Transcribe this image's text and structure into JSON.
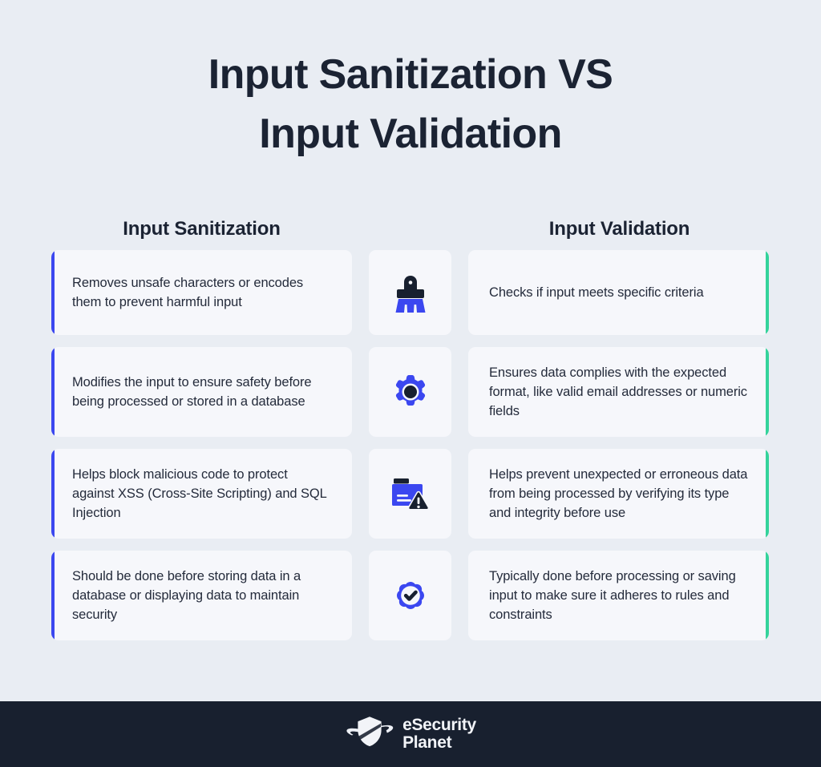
{
  "colors": {
    "page_background": "#E9EDF3",
    "card_background": "#F6F7FB",
    "accent_blue": "#3B47F0",
    "accent_green": "#34D39B",
    "title_text": "#1B2333",
    "footer_background": "#18202F",
    "icon_dark": "#18202F"
  },
  "title": {
    "line1": "Input Sanitization VS",
    "line2": "Input Validation"
  },
  "columns": {
    "left_header": "Input Sanitization",
    "right_header": "Input Validation"
  },
  "rows": [
    {
      "left": "Removes unsafe characters or encodes them to prevent harmful input",
      "icon": "brush-icon",
      "right": "Checks if input meets specific criteria"
    },
    {
      "left": "Modifies the input to ensure safety before being processed or stored in a database",
      "icon": "gear-icon",
      "right": "Ensures data complies with the expected format, like valid email addresses or numeric fields"
    },
    {
      "left": "Helps block malicious code to protect against XSS (Cross-Site Scripting) and SQL Injection",
      "icon": "folder-warning-icon",
      "right": "Helps prevent unexpected or erroneous data from being processed by verifying its type and integrity before use"
    },
    {
      "left": "Should be done before storing data in a database or displaying data to maintain security",
      "icon": "verified-check-icon",
      "right": "Typically done before processing or saving input to make sure it adheres to rules and constraints"
    }
  ],
  "footer": {
    "logo_icon": "shield-planet-logo-icon",
    "brand_line1": "eSecurity",
    "brand_line2": "Planet"
  }
}
